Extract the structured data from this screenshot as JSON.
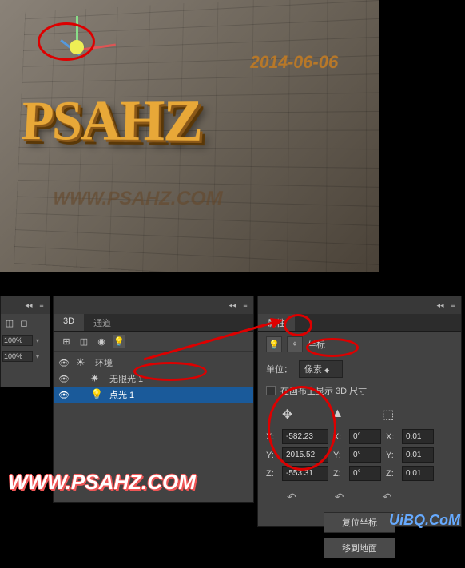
{
  "canvas": {
    "main_text": "PSAHZ",
    "date": "2014-06-06",
    "url": "WWW.PSAHZ.COM"
  },
  "watermark": {
    "main": "WWW.PSAHZ.COM",
    "secondary": "UiBQ.CoM"
  },
  "left_panel": {
    "opacity1": "100%",
    "opacity2": "100%"
  },
  "mid_panel": {
    "tab_3d": "3D",
    "tab_channels": "通道",
    "items": {
      "environment": "环境",
      "infinite_light": "无限光 1",
      "point_light": "点光 1"
    }
  },
  "right_panel": {
    "tab": "属性",
    "coords_label": "坐标",
    "unit_label": "单位：",
    "unit_value": "像素",
    "show_3d_label": "在画布上显示 3D 尺寸",
    "coords": {
      "x_label": "X:",
      "x_val": "-582.23",
      "y_label": "Y:",
      "y_val": "2015.52",
      "z_label": "Z:",
      "z_val": "-553.31",
      "rx_label": "X:",
      "rx_val": "0°",
      "ry_label": "Y:",
      "ry_val": "0°",
      "rz_label": "Z:",
      "rz_val": "0°",
      "sx_label": "X:",
      "sx_val": "0.01",
      "sy_label": "Y:",
      "sy_val": "0.01",
      "sz_label": "Z:",
      "sz_val": "0.01"
    },
    "reset_btn": "复位坐标",
    "move_btn": "移到地面"
  }
}
